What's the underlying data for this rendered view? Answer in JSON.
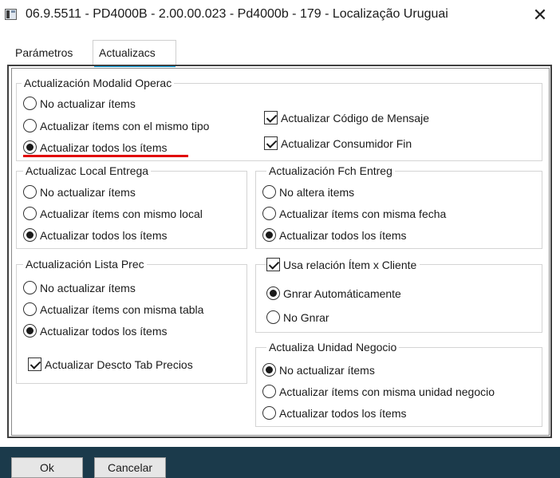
{
  "window": {
    "title": "06.9.5511 - PD4000B - 2.00.00.023 - Pd4000b - 179 - Localização Uruguai",
    "close_glyph": "✕"
  },
  "tabs": [
    {
      "label": "Parámetros",
      "active": false
    },
    {
      "label": "Actualizacs",
      "active": true
    }
  ],
  "colors": {
    "tab_accent": "#00a0e3",
    "highlight_mark": "#e10000",
    "footer": "#1b3a4b"
  },
  "groups": {
    "modalid": {
      "title": "Actualización Modalid Operac",
      "options": [
        "No actualizar ítems",
        "Actualizar ítems con el mismo tipo",
        "Actualizar todos los ítems"
      ],
      "selected": 2,
      "checks": [
        {
          "label": "Actualizar Código de Mensaje",
          "checked": true
        },
        {
          "label": "Actualizar Consumidor Fin",
          "checked": true
        }
      ]
    },
    "local_entrega": {
      "title": "Actualizac Local Entrega",
      "options": [
        "No actualizar ítems",
        "Actualizar ítems con mismo local",
        "Actualizar todos los ítems"
      ],
      "selected": 2
    },
    "fch_entreg": {
      "title": "Actualización Fch Entreg",
      "options": [
        "No altera items",
        "Actualizar ítems con misma fecha",
        "Actualizar todos los ítems"
      ],
      "selected": 2
    },
    "lista_prec": {
      "title": "Actualización Lista Prec",
      "options": [
        "No actualizar ítems",
        "Actualizar ítems con misma tabla",
        "Actualizar todos los ítems"
      ],
      "selected": 2,
      "check": {
        "label": "Actualizar Descto Tab Precios",
        "checked": true
      }
    },
    "relacion": {
      "check": {
        "label": "Usa relación Ítem x Cliente",
        "checked": true
      },
      "options": [
        "Gnrar Automáticamente",
        "No Gnrar"
      ],
      "selected": 0
    },
    "unidad_negocio": {
      "title": "Actualiza Unidad Negocio",
      "options": [
        "No actualizar ítems",
        "Actualizar ítems con misma unidad negocio",
        "Actualizar todos los ítems"
      ],
      "selected": 0
    }
  },
  "buttons": {
    "ok": "Ok",
    "cancel": "Cancelar"
  }
}
